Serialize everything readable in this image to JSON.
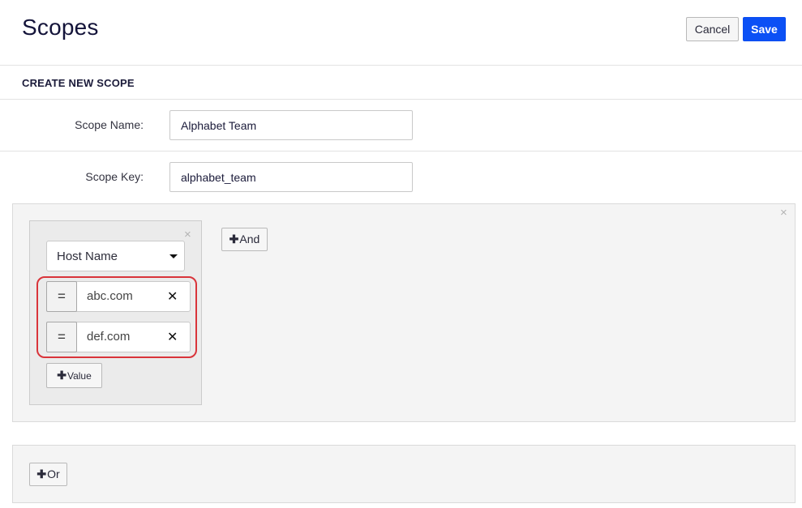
{
  "header": {
    "title": "Scopes",
    "cancel_label": "Cancel",
    "save_label": "Save"
  },
  "section": {
    "title": "CREATE NEW SCOPE"
  },
  "form": {
    "scope_name": {
      "label": "Scope Name:",
      "value": "Alphabet Team"
    },
    "scope_key": {
      "label": "Scope Key:",
      "value": "alphabet_team"
    }
  },
  "rule": {
    "close_glyph": "×",
    "condition": {
      "close_glyph": "×",
      "field_select": "Host Name",
      "values": [
        {
          "operator": "=",
          "value": "abc.com",
          "remove_glyph": "✕"
        },
        {
          "operator": "=",
          "value": "def.com",
          "remove_glyph": "✕"
        }
      ],
      "add_value_label": "Value"
    },
    "and_label": "And"
  },
  "or_section": {
    "or_label": "Or"
  },
  "colors": {
    "save_button": "#0b50f5",
    "highlight_border": "#d9343a",
    "panel_bg": "#f4f4f4",
    "condition_bg": "#ebebeb"
  },
  "icons": {
    "plus_glyph": "✚"
  }
}
